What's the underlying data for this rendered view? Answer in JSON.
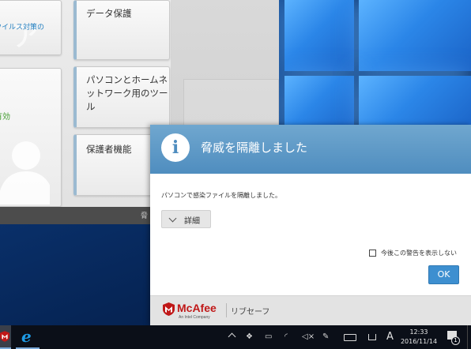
{
  "main_window": {
    "tiles_left": {
      "link_text": "ウイルス対策の",
      "status_text": "有効"
    },
    "tiles_right": [
      {
        "label": "データ保護"
      },
      {
        "label": "パソコンとホームネットワーク用のツール"
      },
      {
        "label": "保護者機能"
      }
    ],
    "bottom_bar_text": "脅"
  },
  "dialog": {
    "title": "脅威を隔離しました",
    "message": "パソコンで感染ファイルを隔離しました。",
    "details_label": "詳細",
    "dont_show_label": "今後この警告を表示しない",
    "dont_show_checked": false,
    "ok_label": "OK",
    "brand": "McAfee",
    "brand_sub": "An Intel Company",
    "product": "リブセーフ"
  },
  "taskbar": {
    "ime_indicator": "A",
    "clock_time": "12:33",
    "clock_date": "2016/11/14",
    "notification_count": "1"
  },
  "colors": {
    "dialog_header": "#5f9ac7",
    "ok_button": "#3d8fd0",
    "mcafee_red": "#c01818",
    "status_green": "#3d9a2a",
    "link_blue": "#1f7dbf"
  }
}
